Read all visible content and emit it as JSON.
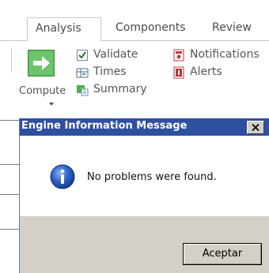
{
  "tabs": [
    {
      "label": "Analysis",
      "active": true
    },
    {
      "label": "Components",
      "active": false
    },
    {
      "label": "Review",
      "active": false
    }
  ],
  "ribbon": {
    "compute_label": "Compute",
    "items": [
      {
        "label": "Validate",
        "icon": "validate-check-icon"
      },
      {
        "label": "Times",
        "icon": "times-table-icon"
      },
      {
        "label": "Summary",
        "icon": "summary-icon"
      },
      {
        "label": "Notifications",
        "icon": "notifications-icon"
      },
      {
        "label": "Alerts",
        "icon": "alerts-icon"
      }
    ]
  },
  "dialog": {
    "title": "Engine Information Message",
    "message": "No problems were found.",
    "ok_label": "Aceptar",
    "icon": "info-icon",
    "close_icon": "close-icon"
  },
  "colors": {
    "titlebar": "#2f4f9f",
    "dialog_footer": "#d4d0c8",
    "compute_green": "#4caf50",
    "info_blue": "#1f4fb4"
  }
}
